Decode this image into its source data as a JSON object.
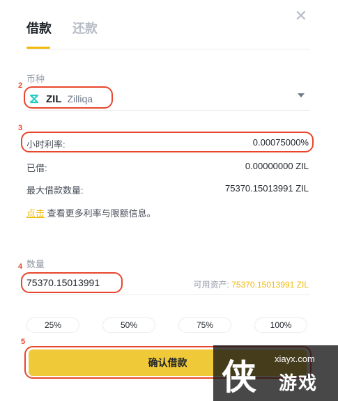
{
  "tabs": [
    {
      "label": "借款",
      "active": true
    },
    {
      "label": "还款",
      "active": false
    }
  ],
  "close_icon": "close-icon",
  "coin": {
    "section_label": "币种",
    "symbol": "ZIL",
    "name": "Zilliqa",
    "icon": "zilliqa-icon"
  },
  "rates": [
    {
      "label": "小时利率:",
      "value": "0.00075000%"
    },
    {
      "label": "已借:",
      "value": "0.00000000 ZIL"
    },
    {
      "label": "最大借款数量:",
      "value": "75370.15013991 ZIL"
    }
  ],
  "more_info": {
    "link": "点击",
    "text": "查看更多利率与限额信息。"
  },
  "amount": {
    "section_label": "数量",
    "value": "75370.15013991",
    "available_label": "可用资产:",
    "available_value": "75370.15013991 ZIL"
  },
  "percent_buttons": [
    "25%",
    "50%",
    "75%",
    "100%"
  ],
  "confirm_label": "确认借款",
  "annotations": [
    "2",
    "3",
    "4",
    "5"
  ],
  "watermark": {
    "char": "侠",
    "url": "xiayx.com",
    "text": "游戏"
  },
  "colors": {
    "accent": "#f0b90b",
    "button": "#f0c939",
    "annotation": "#e8452c"
  }
}
